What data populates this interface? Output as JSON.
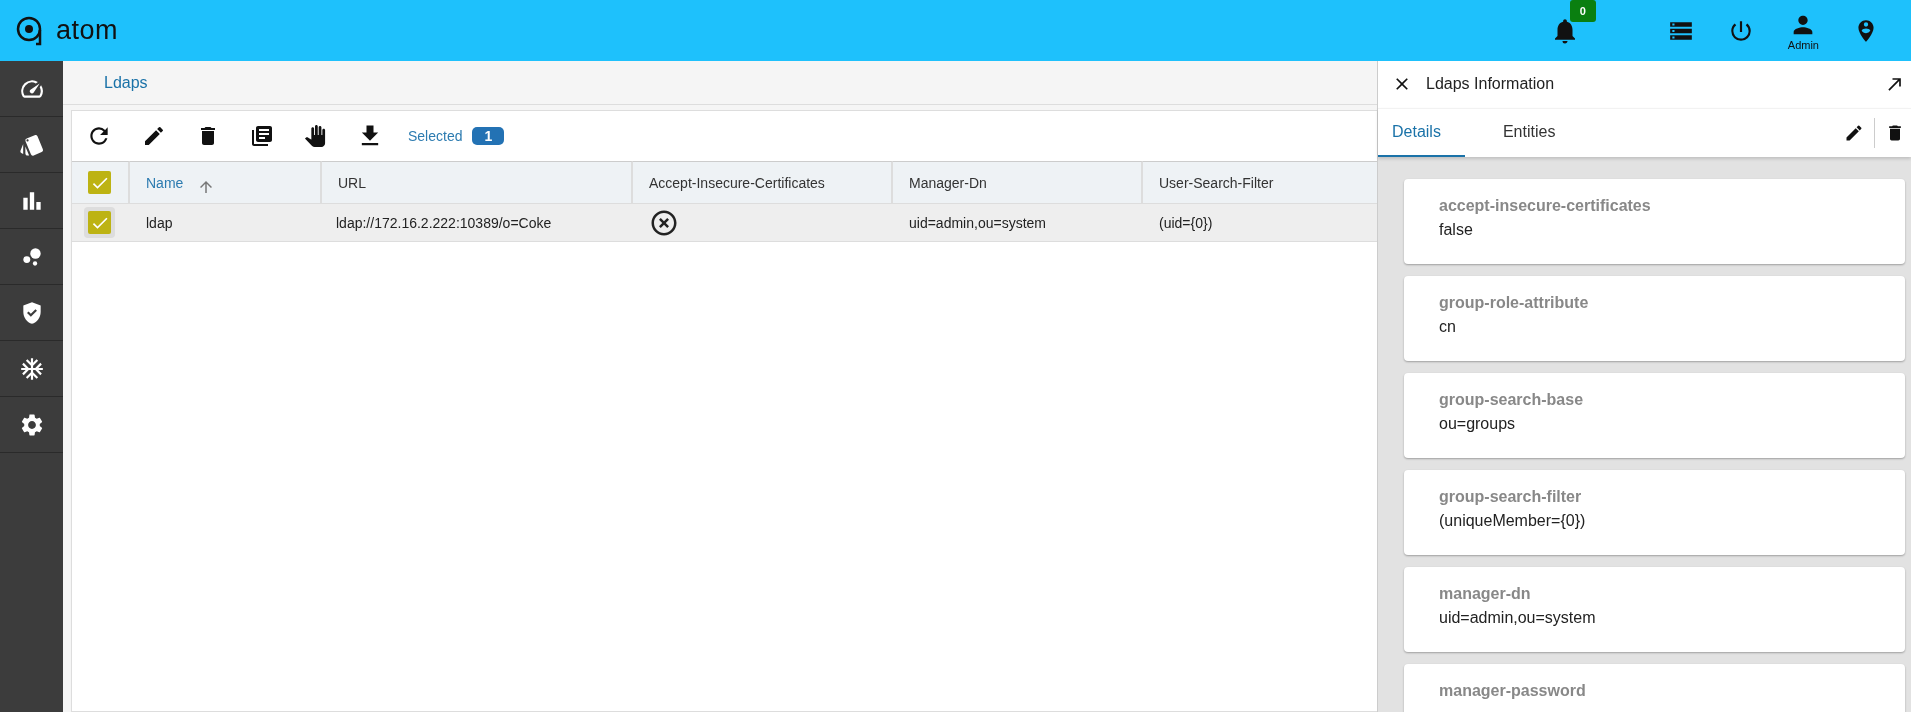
{
  "app": {
    "name": "atom"
  },
  "header": {
    "notification_count": "0",
    "user_label": "Admin"
  },
  "breadcrumb": "Ldaps",
  "toolbar": {
    "selected_label": "Selected",
    "selected_count": "1"
  },
  "table": {
    "all_checked": true,
    "columns": [
      {
        "label": "Name",
        "sorted": true
      },
      {
        "label": "URL",
        "sorted": false
      },
      {
        "label": "Accept-Insecure-Certificates",
        "sorted": false
      },
      {
        "label": "Manager-Dn",
        "sorted": false
      },
      {
        "label": "User-Search-Filter",
        "sorted": false
      }
    ],
    "rows": [
      {
        "checked": true,
        "name": "ldap",
        "url": "ldap://172.16.2.222:10389/o=Coke",
        "accept_insecure": false,
        "manager_dn": "uid=admin,ou=system",
        "user_search_filter": "(uid={0})"
      }
    ]
  },
  "panel": {
    "title": "Ldaps Information",
    "tabs": [
      {
        "label": "Details",
        "selected": true
      },
      {
        "label": "Entities",
        "selected": false
      }
    ],
    "fields": [
      {
        "label": "accept-insecure-certificates",
        "value": "false"
      },
      {
        "label": "group-role-attribute",
        "value": "cn"
      },
      {
        "label": "group-search-base",
        "value": "ou=groups"
      },
      {
        "label": "group-search-filter",
        "value": "(uniqueMember={0})"
      },
      {
        "label": "manager-dn",
        "value": "uid=admin,ou=system"
      },
      {
        "label": "manager-password"
      }
    ]
  }
}
